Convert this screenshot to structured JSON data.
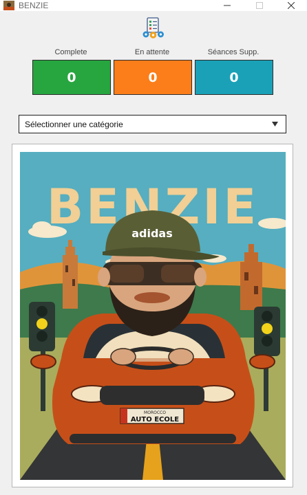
{
  "window": {
    "title": "BENZIE",
    "controls": [
      "minimize-icon",
      "maximize-icon",
      "close-icon"
    ]
  },
  "header": {
    "icon": "checklist-gears-icon"
  },
  "stats": [
    {
      "label": "Complete",
      "value": "0",
      "color": "#27a640"
    },
    {
      "label": "En attente",
      "value": "0",
      "color": "#fb7e1a"
    },
    {
      "label": "Séances Supp.",
      "value": "0",
      "color": "#1aa1b8"
    }
  ],
  "category_select": {
    "value": "Sélectionner une catégorie",
    "icon": "chevron-down-icon"
  },
  "poster": {
    "headline": "BENZIE",
    "cap_brand": "adidas",
    "plate_top": "MOROCCO",
    "plate_text": "AUTO ECOLE",
    "colors": {
      "sky": "#56aec0",
      "car": "#c64f19",
      "headline": "#f1cf95",
      "road": "#343536"
    }
  }
}
